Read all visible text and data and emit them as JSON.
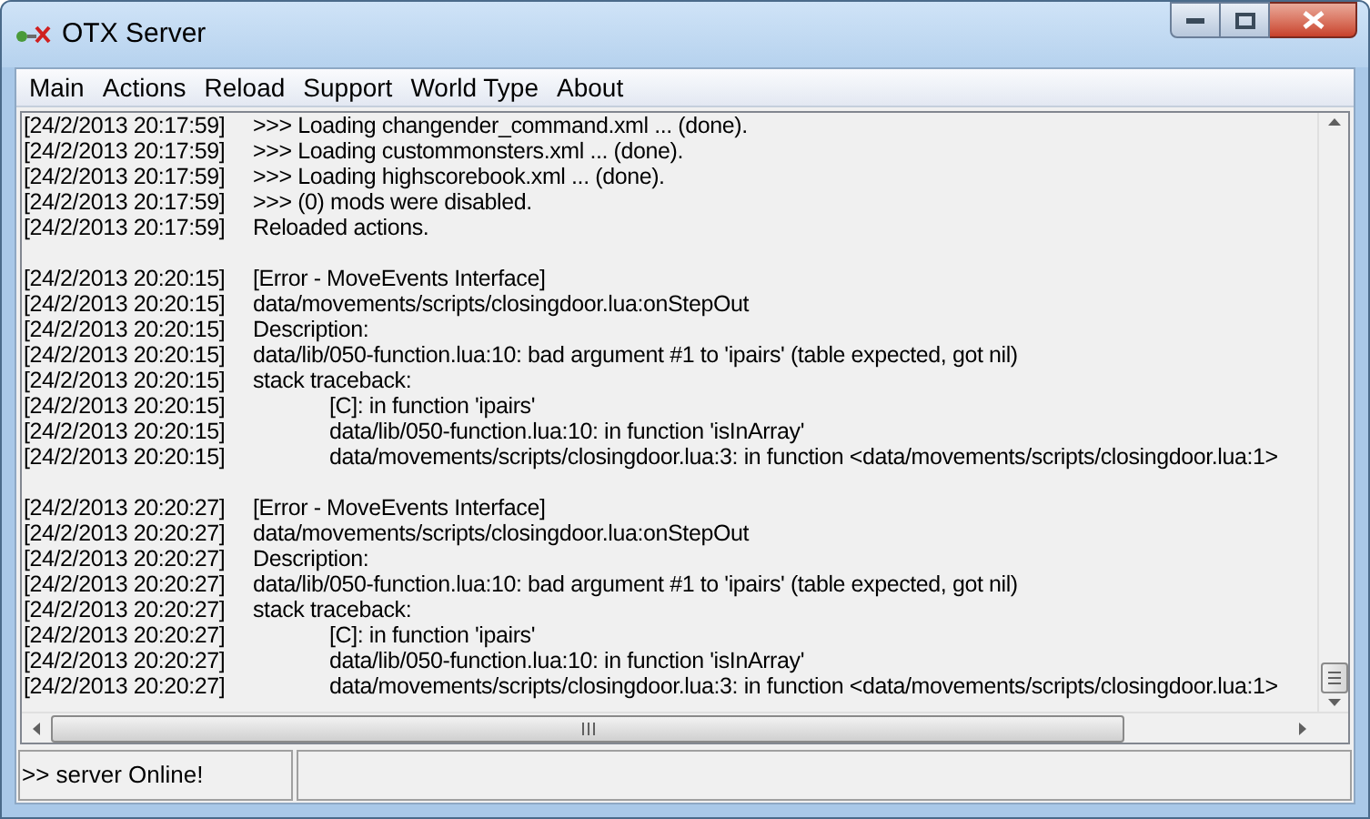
{
  "window": {
    "title": "OTX Server"
  },
  "menu": [
    "Main",
    "Actions",
    "Reload",
    "Support",
    "World Type",
    "About"
  ],
  "log": [
    {
      "kind": "entry",
      "time": "[24/2/2013 20:17:59]",
      "text": ">>> Loading changender_command.xml ... (done)."
    },
    {
      "kind": "entry",
      "time": "[24/2/2013 20:17:59]",
      "text": ">>> Loading custommonsters.xml ... (done)."
    },
    {
      "kind": "entry",
      "time": "[24/2/2013 20:17:59]",
      "text": ">>> Loading highscorebook.xml ... (done)."
    },
    {
      "kind": "entry",
      "time": "[24/2/2013 20:17:59]",
      "text": ">>> (0) mods were disabled."
    },
    {
      "kind": "entry",
      "time": "[24/2/2013 20:17:59]",
      "text": "Reloaded actions."
    },
    {
      "kind": "blank"
    },
    {
      "kind": "entry",
      "time": "[24/2/2013 20:20:15]",
      "text": "[Error - MoveEvents Interface]"
    },
    {
      "kind": "entry",
      "time": "[24/2/2013 20:20:15]",
      "text": "data/movements/scripts/closingdoor.lua:onStepOut"
    },
    {
      "kind": "entry",
      "time": "[24/2/2013 20:20:15]",
      "text": "Description:"
    },
    {
      "kind": "entry",
      "time": "[24/2/2013 20:20:15]",
      "text": "data/lib/050-function.lua:10: bad argument #1 to 'ipairs' (table expected, got nil)"
    },
    {
      "kind": "entry",
      "time": "[24/2/2013 20:20:15]",
      "text": "stack traceback:"
    },
    {
      "kind": "trace",
      "time": "[24/2/2013 20:20:15]",
      "text": "[C]: in function 'ipairs'"
    },
    {
      "kind": "trace",
      "time": "[24/2/2013 20:20:15]",
      "text": "data/lib/050-function.lua:10: in function 'isInArray'"
    },
    {
      "kind": "trace",
      "time": "[24/2/2013 20:20:15]",
      "text": "data/movements/scripts/closingdoor.lua:3: in function <data/movements/scripts/closingdoor.lua:1>"
    },
    {
      "kind": "blank"
    },
    {
      "kind": "entry",
      "time": "[24/2/2013 20:20:27]",
      "text": "[Error - MoveEvents Interface]"
    },
    {
      "kind": "entry",
      "time": "[24/2/2013 20:20:27]",
      "text": "data/movements/scripts/closingdoor.lua:onStepOut"
    },
    {
      "kind": "entry",
      "time": "[24/2/2013 20:20:27]",
      "text": "Description:"
    },
    {
      "kind": "entry",
      "time": "[24/2/2013 20:20:27]",
      "text": "data/lib/050-function.lua:10: bad argument #1 to 'ipairs' (table expected, got nil)"
    },
    {
      "kind": "entry",
      "time": "[24/2/2013 20:20:27]",
      "text": "stack traceback:"
    },
    {
      "kind": "trace",
      "time": "[24/2/2013 20:20:27]",
      "text": "[C]: in function 'ipairs'"
    },
    {
      "kind": "trace",
      "time": "[24/2/2013 20:20:27]",
      "text": "data/lib/050-function.lua:10: in function 'isInArray'"
    },
    {
      "kind": "trace",
      "time": "[24/2/2013 20:20:27]",
      "text": "data/movements/scripts/closingdoor.lua:3: in function <data/movements/scripts/closingdoor.lua:1>"
    }
  ],
  "status_bar": {
    "message": ">> server Online!"
  }
}
